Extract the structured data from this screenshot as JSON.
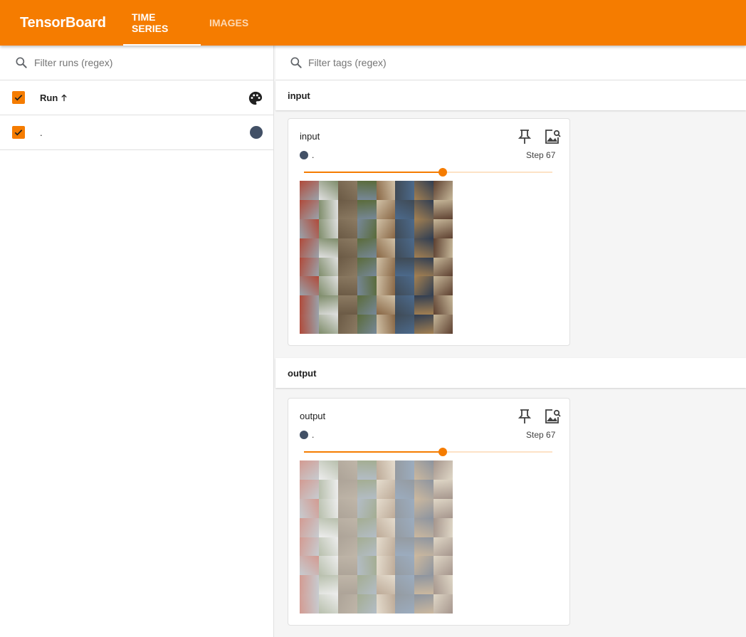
{
  "app": {
    "title": "TensorBoard"
  },
  "tabs": [
    {
      "label": "TIME SERIES",
      "active": true
    },
    {
      "label": "IMAGES",
      "active": false
    }
  ],
  "sidebar": {
    "filter_placeholder": "Filter runs (regex)",
    "column_label": "Run",
    "sort_icon": "arrow-up-icon",
    "runs": [
      {
        "name": ".",
        "checked": true,
        "color": "#425066"
      }
    ]
  },
  "main": {
    "filter_placeholder": "Filter tags (regex)",
    "groups": [
      {
        "name": "input",
        "card": {
          "title": "input",
          "run": ".",
          "step_label": "Step 67",
          "slider_fraction": 0.56,
          "image": "8x8 grid of small photos (animals, vehicles)",
          "faded": false
        }
      },
      {
        "name": "output",
        "card": {
          "title": "output",
          "run": ".",
          "step_label": "Step 67",
          "slider_fraction": 0.56,
          "image": "8x8 grid of small photos, washed out",
          "faded": true
        }
      }
    ]
  },
  "colors": {
    "accent": "#f57c00",
    "run_color": "#425066"
  },
  "icons": [
    "search-icon",
    "palette-icon",
    "pin-icon",
    "image-search-icon",
    "checkmark-icon"
  ]
}
